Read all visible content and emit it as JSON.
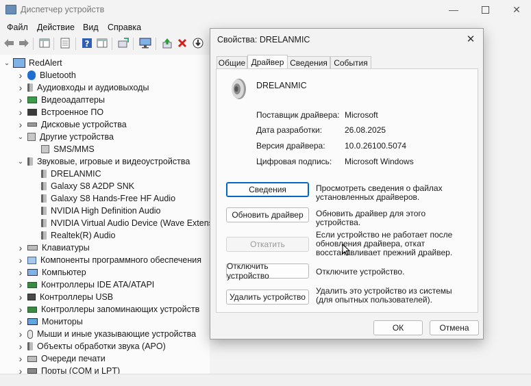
{
  "window": {
    "title": "Диспетчер устройств"
  },
  "menu": [
    "Файл",
    "Действие",
    "Вид",
    "Справка"
  ],
  "tree": {
    "root": "RedAlert",
    "items": [
      {
        "label": "Bluetooth",
        "icon": "bluetooth-icon",
        "level": 1,
        "expanded": false
      },
      {
        "label": "Аудиовходы и аудиовыходы",
        "icon": "speaker-icon",
        "level": 1,
        "expanded": false
      },
      {
        "label": "Видеоадаптеры",
        "icon": "display-adapter-icon",
        "level": 1,
        "expanded": false
      },
      {
        "label": "Встроенное ПО",
        "icon": "firmware-icon",
        "level": 1,
        "expanded": false
      },
      {
        "label": "Дисковые устройства",
        "icon": "disk-icon",
        "level": 1,
        "expanded": false
      },
      {
        "label": "Другие устройства",
        "icon": "unknown-device-icon",
        "level": 1,
        "expanded": true
      },
      {
        "label": "SMS/MMS",
        "icon": "unknown-device-icon",
        "level": 2
      },
      {
        "label": "Звуковые, игровые и видеоустройства",
        "icon": "speaker-icon",
        "level": 1,
        "expanded": true
      },
      {
        "label": "DRELANMIC",
        "icon": "speaker-icon",
        "level": 2
      },
      {
        "label": "Galaxy S8 A2DP SNK",
        "icon": "speaker-icon",
        "level": 2
      },
      {
        "label": "Galaxy S8 Hands-Free HF Audio",
        "icon": "speaker-icon",
        "level": 2
      },
      {
        "label": "NVIDIA High Definition Audio",
        "icon": "speaker-icon",
        "level": 2
      },
      {
        "label": "NVIDIA Virtual Audio Device (Wave Extensible)",
        "icon": "speaker-icon",
        "level": 2
      },
      {
        "label": "Realtek(R) Audio",
        "icon": "speaker-icon",
        "level": 2
      },
      {
        "label": "Клавиатуры",
        "icon": "keyboard-icon",
        "level": 1,
        "expanded": false
      },
      {
        "label": "Компоненты программного обеспечения",
        "icon": "software-component-icon",
        "level": 1,
        "expanded": false
      },
      {
        "label": "Компьютер",
        "icon": "computer-icon",
        "level": 1,
        "expanded": false
      },
      {
        "label": "Контроллеры IDE ATA/ATAPI",
        "icon": "ide-controller-icon",
        "level": 1,
        "expanded": false
      },
      {
        "label": "Контроллеры USB",
        "icon": "usb-icon",
        "level": 1,
        "expanded": false
      },
      {
        "label": "Контроллеры запоминающих устройств",
        "icon": "storage-controller-icon",
        "level": 1,
        "expanded": false
      },
      {
        "label": "Мониторы",
        "icon": "monitor-icon",
        "level": 1,
        "expanded": false
      },
      {
        "label": "Мыши и иные указывающие устройства",
        "icon": "mouse-icon",
        "level": 1,
        "expanded": false
      },
      {
        "label": "Объекты обработки звука (APO)",
        "icon": "speaker-icon",
        "level": 1,
        "expanded": false
      },
      {
        "label": "Очереди печати",
        "icon": "printer-icon",
        "level": 1,
        "expanded": false
      },
      {
        "label": "Порты (COM и LPT)",
        "icon": "port-icon",
        "level": 1,
        "expanded": false
      }
    ]
  },
  "dialog": {
    "title": "Свойства: DRELANMIC",
    "tabs": [
      "Общие",
      "Драйвер",
      "Сведения",
      "События"
    ],
    "active_tab": "Драйвер",
    "device_name": "DRELANMIC",
    "props": [
      {
        "label": "Поставщик драйвера:",
        "value": "Microsoft"
      },
      {
        "label": "Дата разработки:",
        "value": "26.08.2025"
      },
      {
        "label": "Версия драйвера:",
        "value": "10.0.26100.5074"
      },
      {
        "label": "Цифровая подпись:",
        "value": "Microsoft Windows"
      }
    ],
    "actions": [
      {
        "button": "Сведения",
        "desc": "Просмотреть сведения о файлах установленных драйверов.",
        "enabled": true
      },
      {
        "button": "Обновить драйвер",
        "desc": "Обновить драйвер для этого устройства.",
        "enabled": true
      },
      {
        "button": "Откатить",
        "desc": "Если устройство не работает после обновления драйвера, откат восстанавливает прежний драйвер.",
        "enabled": false
      },
      {
        "button": "Отключить устройство",
        "desc": "Отключите устройство.",
        "enabled": true
      },
      {
        "button": "Удалить устройство",
        "desc": "Удалить это устройство из системы (для опытных пользователей).",
        "enabled": true
      }
    ],
    "ok": "ОК",
    "cancel": "Отмена"
  }
}
